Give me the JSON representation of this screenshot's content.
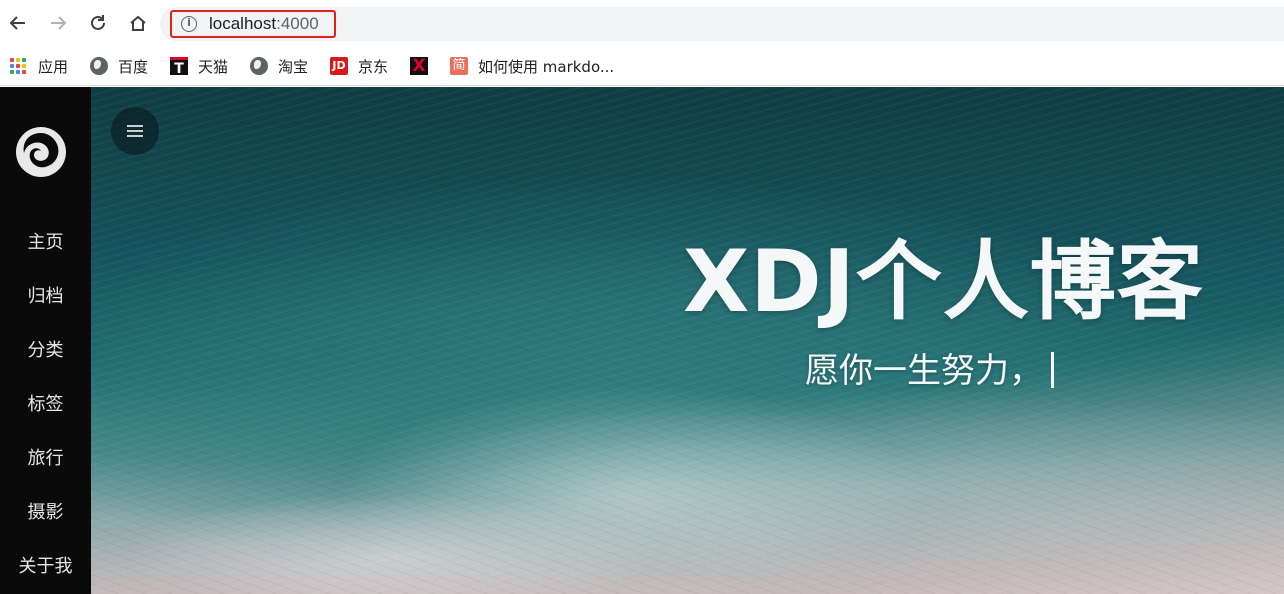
{
  "browser": {
    "url_host": "localhost",
    "url_port": ":4000"
  },
  "bookmarks": [
    {
      "label": "应用",
      "icon": "apps-grid-icon"
    },
    {
      "label": "百度",
      "icon": "globe-icon"
    },
    {
      "label": "天猫",
      "icon": "tmall-icon"
    },
    {
      "label": "淘宝",
      "icon": "globe-icon"
    },
    {
      "label": "京东",
      "icon": "jd-icon"
    },
    {
      "label": "",
      "icon": "x-icon"
    },
    {
      "label": "如何使用 markdo...",
      "icon": "jianshu-icon"
    }
  ],
  "icons": {
    "tmall_glyph": "T",
    "jd_glyph": "JD",
    "x_glyph": "X",
    "jianshu_glyph": "简"
  },
  "sidebar": {
    "items": [
      {
        "label": "主页"
      },
      {
        "label": "归档"
      },
      {
        "label": "分类"
      },
      {
        "label": "标签"
      },
      {
        "label": "旅行"
      },
      {
        "label": "摄影"
      },
      {
        "label": "关于我"
      }
    ]
  },
  "hero": {
    "title": "XDJ个人博客",
    "subtitle": "愿你一生努力，"
  },
  "colors": {
    "url_highlight": "#e0201b",
    "sidebar_bg": "#0a0a0a",
    "ocean_deep": "#0f3e43",
    "ocean_mid": "#1f6c70"
  }
}
